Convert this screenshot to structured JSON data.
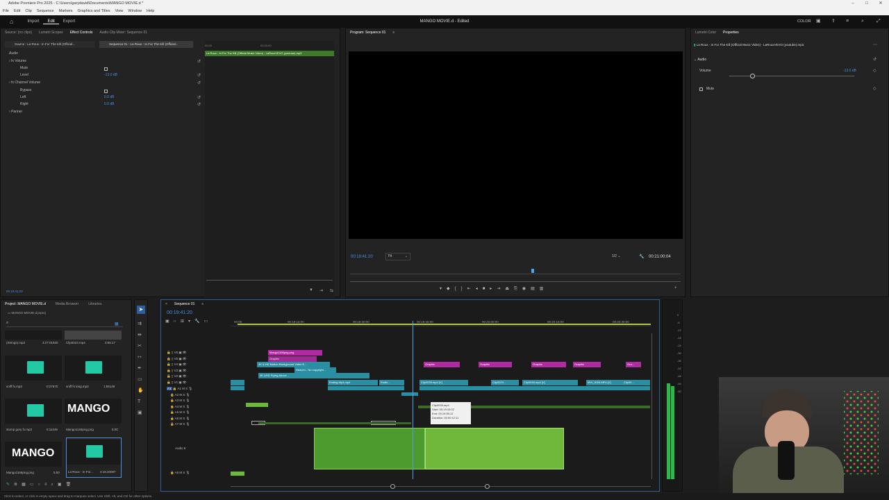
{
  "app": {
    "title": "Adobe Premiere Pro 2025 - C:\\Users\\garydavid\\Documents\\MANGO MOVIE.d *",
    "menu": [
      "File",
      "Edit",
      "Clip",
      "Sequence",
      "Markers",
      "Graphics and Titles",
      "View",
      "Window",
      "Help"
    ],
    "workspace_tabs": [
      "Import",
      "Edit",
      "Export"
    ],
    "project_title": "MANGO MOVIE.d - Edited",
    "color_label": "COLOR"
  },
  "source_panel": {
    "tabs": [
      "Source: (no clips)",
      "Lumetri Scopes",
      "Effect Controls",
      "Audio Clip Mixer: Sequence 01"
    ],
    "source_clip": "Source - La Roux - In For The Kill (Official...",
    "sequence_clip": "Sequence 01 - La Roux - In For The Kill (Official...",
    "timeline_clip_label": "La Roux - In For The Kill (Official Music Video) - LaRouxVEVO (youtube).mp3",
    "section": "Audio",
    "volume_label": "Volume",
    "mute_label": "Mute",
    "level_label": "Level",
    "level_value": "-13.0 dB",
    "channel_volume_label": "Channel Volume",
    "bypass_label": "Bypass",
    "left_label": "Left",
    "left_value": "0.0 dB",
    "right_label": "Right",
    "right_value": "0.0 dB",
    "panner_label": "Panner",
    "timecode": "00:19:41:20",
    "ruler_left": "00:00",
    "ruler_right": "00:20:00"
  },
  "program_monitor": {
    "title": "Program: Sequence 01",
    "timecode": "00:19:41:20",
    "fit": "Fit",
    "resolution": "1/2",
    "duration": "00:21:00:04"
  },
  "properties_panel": {
    "tabs": [
      "Lumetri Color",
      "Properties"
    ],
    "clip_name": "La Roux - In For The Kill (Official Music Video) - LaRouxVEVO (youtube).mp3",
    "section": "Audio",
    "volume_label": "Volume",
    "volume_value": "-13.0 dB",
    "mute_label": "Mute"
  },
  "project_panel": {
    "tabs": [
      "Project: MANGO MOVIE.d",
      "Media Browser",
      "Libraries"
    ],
    "file": "MANGO MOVIE.d.prproj",
    "items": [
      {
        "name": "(Strings).mp3",
        "duration": "3:27:01920",
        "kind": "audio"
      },
      {
        "name": "Clip0023.mp4",
        "duration": "3:55:17",
        "kind": "video"
      },
      {
        "name": "sniff fx.mp3",
        "duration": "0:27670",
        "kind": "audio"
      },
      {
        "name": "sniff fx long.mp3",
        "duration": "1:55149",
        "kind": "audio"
      },
      {
        "name": "stomp gory fx.mp3",
        "duration": "5:11249",
        "kind": "audio"
      },
      {
        "name": "Mango1133png.png",
        "duration": "5:00",
        "kind": "image",
        "text": "MANGO"
      },
      {
        "name": "Mango1166png.png",
        "duration": "5:00",
        "kind": "image",
        "text": "MANGO"
      },
      {
        "name": "La Roux - In For...",
        "duration": "4:16:20087",
        "kind": "audio"
      }
    ]
  },
  "timeline": {
    "title": "Sequence 01",
    "timecode": "00:19:41:20",
    "ruler": [
      "00:00",
      "00:19:15:00",
      "00:19:30:00",
      "00:19:45:00",
      "00:20:00:00",
      "00:20:15:00",
      "00:20:30:00"
    ],
    "video_tracks": [
      "V6",
      "V5",
      "V4",
      "V3",
      "V2",
      "V1"
    ],
    "audio_tracks": [
      "A1",
      "A2",
      "A3",
      "A4",
      "A5",
      "A6",
      "A7",
      "A8"
    ],
    "audio8_label": "Audio 8",
    "clips": {
      "v6": "Mango1166png.png",
      "v5": "Graphic",
      "v4": "4K & HD Motion Background Video E...",
      "v3": "Heaven - No copyright...",
      "v2": "4K UHD Flying Above...",
      "v1a": "Ending.Mp4.mp4",
      "v1b": "Endin...",
      "v1c": "Clip0035.mp4 [V]",
      "v1d": "Clip0023...",
      "v1e": "Clip0046.mp4 [V]",
      "v1f": "MVI_0026.MP4 [V]",
      "v1g": "Clip00...",
      "graphic": "Graphic",
      "graphic_short": "Gra..."
    },
    "tooltip": {
      "name": "Clip0035.mp4",
      "start": "Start: 00:19:43:02",
      "end": "End: 00:19:55:12",
      "duration": "Duration: 00:00:12:11"
    },
    "meter_scale": [
      "0",
      "-6",
      "-12",
      "-18",
      "-24",
      "-30",
      "-36",
      "-42",
      "-48",
      "-54",
      "-60"
    ]
  },
  "status_bar": "Click to select, or click in empty space and drag to marquee select. Use Shift, Alt, and Ctrl for other options.",
  "colors": {
    "accent_blue": "#4a8fe3",
    "clip_pink": "#b12aa3",
    "clip_teal": "#2a8fa3",
    "audio_green": "#4d9a2e",
    "playhead": "#4aa3f0"
  }
}
